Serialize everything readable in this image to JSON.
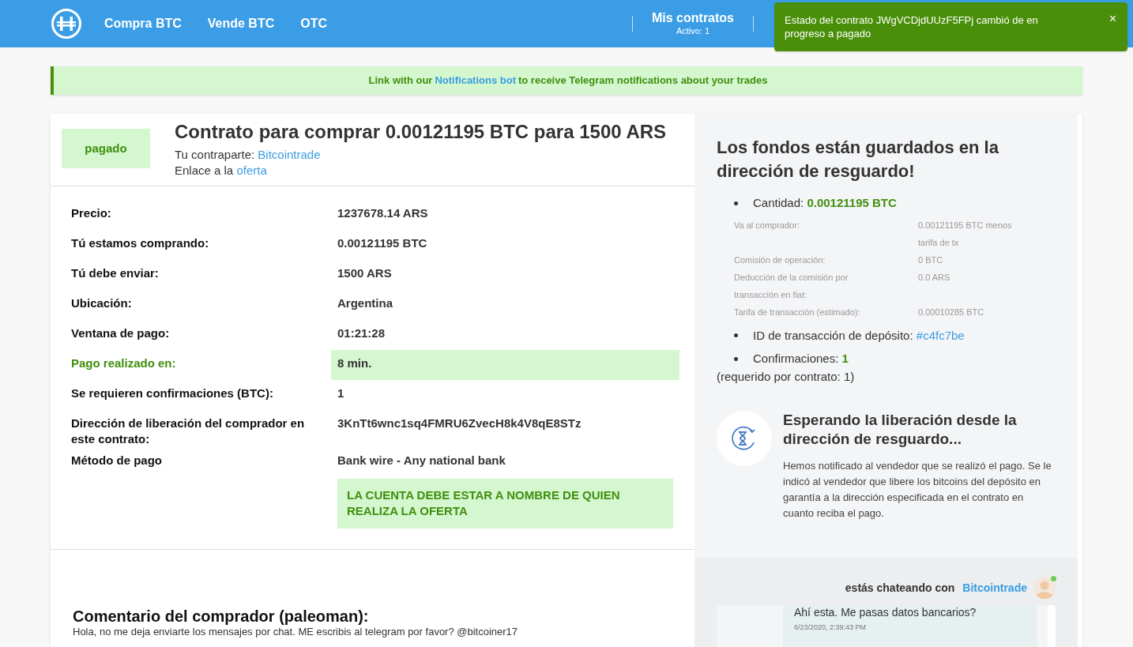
{
  "nav": {
    "links": [
      "Compra BTC",
      "Vende BTC",
      "OTC"
    ],
    "contracts": {
      "label": "Mis contratos",
      "sublabel": "Activo: 1"
    }
  },
  "toast": {
    "message": "Estado del contrato JWgVCDjdUUzF5FPj cambió de en progreso a pagado",
    "close": "×"
  },
  "banner": {
    "before": "Link with our",
    "link": "Notifications bot",
    "after": "to receive Telegram notifications about your trades"
  },
  "contract": {
    "status": "pagado",
    "title": "Contrato para comprar 0.00121195 BTC para 1500 ARS",
    "counterparty_label": "Tu contraparte:",
    "counterparty": "Bitcointrade",
    "offer_label": "Enlace a la",
    "offer_link": "oferta",
    "details": [
      {
        "label": "Precio:",
        "value": "1237678.14 ARS",
        "highlight": false
      },
      {
        "label": "Tú estamos comprando:",
        "value": "0.00121195 BTC",
        "highlight": false
      },
      {
        "label": "Tú debe enviar:",
        "value": "1500 ARS",
        "highlight": false
      },
      {
        "label": "Ubicación:",
        "value": "Argentina",
        "highlight": false
      },
      {
        "label": "Ventana de pago:",
        "value": "01:21:28",
        "highlight": false
      },
      {
        "label": "Pago realizado en:",
        "value": "8  min.",
        "highlight": true
      },
      {
        "label": "Se requieren confirmaciones (BTC):",
        "value": "1",
        "highlight": false
      },
      {
        "label": "Dirección de liberación del comprador en este contrato:",
        "value": "3KnTt6wnc1sq4FMRU6ZvecH8k4V8qE8STz",
        "highlight": false
      },
      {
        "label": "Método de pago",
        "value": "Bank wire - Any national bank",
        "highlight": false
      }
    ],
    "payment_note": "LA CUENTA DEBE ESTAR A NOMBRE DE QUIEN REALIZA LA OFERTA",
    "comment_title": "Comentario del comprador (paleoman):",
    "comment": "Hola, no me deja enviarte los mensajes por chat. ME escribis al telegram por favor? @bitcoiner17"
  },
  "escrow": {
    "title": "Los fondos están guardados en la dirección de resguardo!",
    "amount_label": "Cantidad:",
    "amount": "0.00121195  BTC",
    "breakdown": [
      {
        "label": "Va al comprador:",
        "value": "0.00121195 BTC menos tarifa de tx"
      },
      {
        "label": "Comisión de operación:",
        "value": "0 BTC"
      },
      {
        "label": "Deducción de la comisión por transacción en fiat:",
        "value": "0.0 ARS"
      },
      {
        "label": "Tarifa de transacción (estimado):",
        "value": "0.00010285 BTC"
      }
    ],
    "deposit_label": "ID de transacción de depósito:",
    "deposit_id": "#c4fc7be",
    "confirmations_label": "Confirmaciones:",
    "confirmations": "1",
    "required": "(requerido por contrato: 1)"
  },
  "waiting": {
    "title": "Esperando la liberación desde la dirección de resguardo...",
    "text": "Hemos notificado al vendedor que se realizó el pago. Se le indicó al vendedor que libere los bitcoins del depósito en garantía a la dirección especificada en el contrato en cuanto reciba el pago."
  },
  "chat": {
    "label": "estás chateando con",
    "partner": "Bitcointrade",
    "online": true,
    "messages": [
      {
        "text": "Ahí esta. Me pasas datos bancarios?",
        "time": "6/23/2020, 2:39:43 PM"
      }
    ]
  }
}
